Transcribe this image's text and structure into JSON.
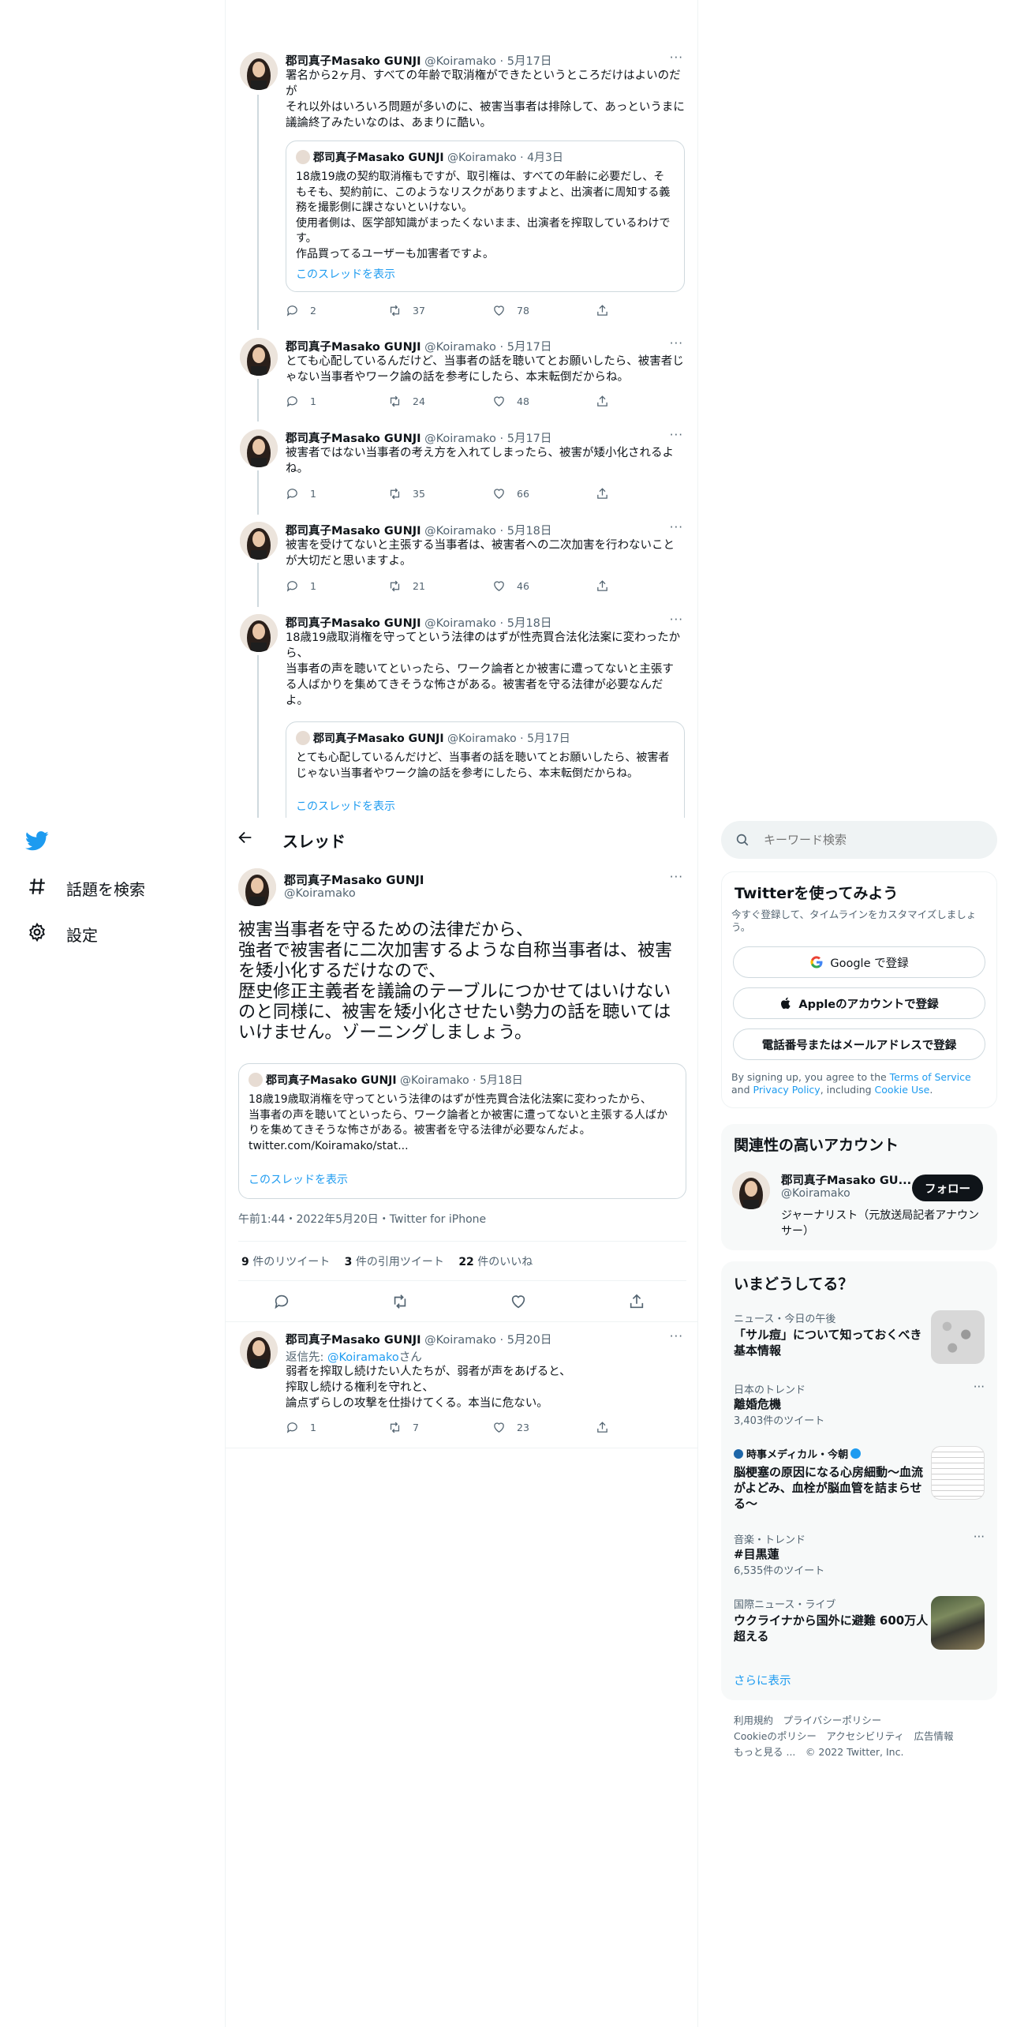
{
  "nav": {
    "explore": "話題を検索",
    "settings": "設定"
  },
  "header": {
    "title": "スレッド"
  },
  "user": {
    "name": "郡司真子Masako GUNJI",
    "handle": "@Koiramako"
  },
  "thread": [
    {
      "date": "5月17日",
      "text": "署名から2ヶ月、すべての年齢で取消権ができたというところだけはよいのだが\nそれ以外はいろいろ問題が多いのに、被害当事者は排除して、あっというまに議論終了みたいなのは、あまりに酷い。",
      "quote": {
        "date": "4月3日",
        "text": "18歳19歳の契約取消権もですが、取引権は、すべての年齢に必要だし、そもそも、契約前に、このようなリスクがありますよと、出演者に周知する義務を撮影側に課さないといけない。\n使用者側は、医学部知識がまったくないまま、出演者を搾取しているわけです。\n作品買ってるユーザーも加害者ですよ。",
        "show_thread": "このスレッドを表示"
      },
      "replies": "2",
      "retweets": "37",
      "likes": "78"
    },
    {
      "date": "5月17日",
      "text": "とても心配しているんだけど、当事者の話を聴いてとお願いしたら、被害者じゃない当事者やワーク論の話を参考にしたら、本末転倒だからね。",
      "replies": "1",
      "retweets": "24",
      "likes": "48"
    },
    {
      "date": "5月17日",
      "text": "被害者ではない当事者の考え方を入れてしまったら、被害が矮小化されるよね。",
      "replies": "1",
      "retweets": "35",
      "likes": "66"
    },
    {
      "date": "5月18日",
      "text": "被害を受けてないと主張する当事者は、被害者への二次加害を行わないことが大切だと思いますよ。",
      "replies": "1",
      "retweets": "21",
      "likes": "46"
    },
    {
      "date": "5月18日",
      "text": "18歳19歳取消権を守ってという法律のはずが性売買合法化法案に変わったから、\n当事者の声を聴いてといったら、ワーク論者とか被害に遭ってないと主張する人ばかりを集めてきそうな怖さがある。被害者を守る法律が必要なんだよ。",
      "quote": {
        "date": "5月17日",
        "text": "とても心配しているんだけど、当事者の話を聴いてとお願いしたら、被害者じゃない当事者やワーク論の話を参考にしたら、本末転倒だからね。",
        "show_thread": "このスレッドを表示"
      }
    }
  ],
  "main": {
    "text": "被害当事者を守るための法律だから、\n強者で被害者に二次加害するような自称当事者は、被害を矮小化するだけなので、\n歴史修正主義者を議論のテーブルにつかせてはいけないのと同様に、被害を矮小化させたい勢力の話を聴いてはいけません。ゾーニングしましょう。",
    "quote": {
      "date": "5月18日",
      "text": "18歳19歳取消権を守ってという法律のはずが性売買合法化法案に変わったから、\n当事者の声を聴いてといったら、ワーク論者とか被害に遭ってないと主張する人ばかりを集めてきそうな怖さがある。被害者を守る法律が必要なんだよ。\ntwitter.com/Koiramako/stat...",
      "show_thread": "このスレッドを表示"
    },
    "timestamp": "午前1:44・2022年5月20日・Twitter for iPhone",
    "retweets_n": "9",
    "retweets_l": "件のリツイート",
    "quotes_n": "3",
    "quotes_l": "件の引用ツイート",
    "likes_n": "22",
    "likes_l": "件のいいね"
  },
  "reply": {
    "date": "5月20日",
    "to_label": "返信先: ",
    "to_handle": "@Koiramako",
    "to_suffix": "さん",
    "text": "弱者を搾取し続けたい人たちが、弱者が声をあげると、\n搾取し続ける権利を守れと、\n論点ずらしの攻撃を仕掛けてくる。本当に危ない。",
    "replies": "1",
    "retweets": "7",
    "likes": "23"
  },
  "sidebar": {
    "search_placeholder": "キーワード検索",
    "signup": {
      "title": "Twitterを使ってみよう",
      "sub": "今すぐ登録して、タイムラインをカスタマイズしましょう。",
      "google": "Google で登録",
      "apple": "Appleのアカウントで登録",
      "phone": "電話番号またはメールアドレスで登録",
      "legal_a": "By signing up, you agree to the ",
      "tos": "Terms of Service",
      "legal_b": " and ",
      "privacy": "Privacy Policy",
      "legal_c": ", including ",
      "cookie": "Cookie Use",
      "legal_d": "."
    },
    "related": {
      "title": "関連性の高いアカウント",
      "name": "郡司真子Masako GU...",
      "handle": "@Koiramako",
      "follow": "フォロー",
      "bio": "ジャーナリスト（元放送局記者アナウンサー）"
    },
    "trends_title": "いまどうしてる？",
    "trends": [
      {
        "meta": "ニュース・今日の午後",
        "title": "「サル痘」について知っておくべき基本情報"
      },
      {
        "meta": "日本のトレンド",
        "title": "離婚危機",
        "count": "3,403件のツイート"
      },
      {
        "meta": "時事メディカル・今朝",
        "title": "脳梗塞の原因になる心房細動～血流がよどみ、血栓が脳血管を詰まらせる～"
      },
      {
        "meta": "音楽・トレンド",
        "title": "#目黒蓮",
        "count": "6,535件のツイート"
      },
      {
        "meta": "国際ニュース・ライブ",
        "title": "ウクライナから国外に避難 600万人超える"
      }
    ],
    "show_more": "さらに表示",
    "footer": {
      "l1": "利用規約　プライバシーポリシー",
      "l2": "Cookieのポリシー　アクセシビリティ　広告情報",
      "l3": "もっと見る ...　© 2022 Twitter, Inc."
    }
  }
}
